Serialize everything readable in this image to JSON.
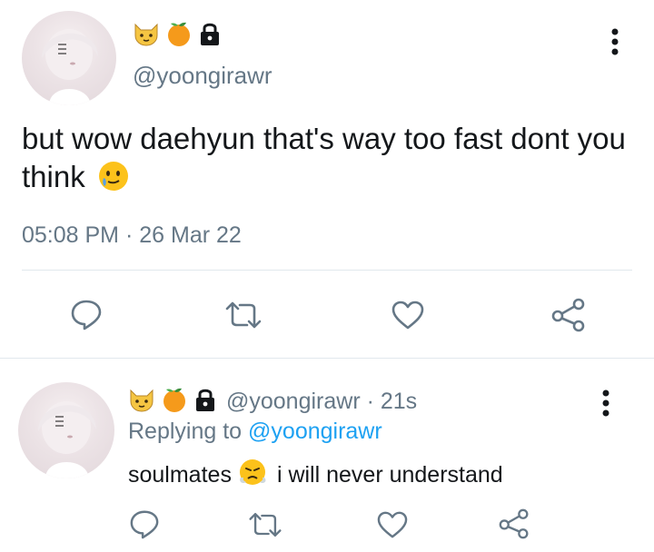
{
  "main_tweet": {
    "emojis": [
      "cat-face-icon",
      "tangerine-icon",
      "lock-icon"
    ],
    "handle": "@yoongirawr",
    "text": "but wow daehyun that's way too fast dont you think",
    "text_emoji": "crying-smile-face-icon",
    "time": "05:08 PM",
    "separator": " · ",
    "date": "26 Mar 22",
    "actions": [
      "reply-icon",
      "retweet-icon",
      "like-icon",
      "share-icon"
    ]
  },
  "reply_tweet": {
    "emojis": [
      "cat-face-icon",
      "tangerine-icon",
      "lock-icon"
    ],
    "handle": "@yoongirawr",
    "separator": " · ",
    "age": "21s",
    "replying_prefix": "Replying to ",
    "replying_to": "@yoongirawr",
    "text_before": "soulmates",
    "text_emoji": "steam-from-nose-face-icon",
    "text_after": "i will never understand",
    "actions": [
      "reply-icon",
      "retweet-icon",
      "like-icon",
      "share-icon"
    ]
  },
  "colors": {
    "text": "#14171a",
    "secondary": "#657786",
    "link": "#1da1f2",
    "divider": "#e1e8ed"
  }
}
